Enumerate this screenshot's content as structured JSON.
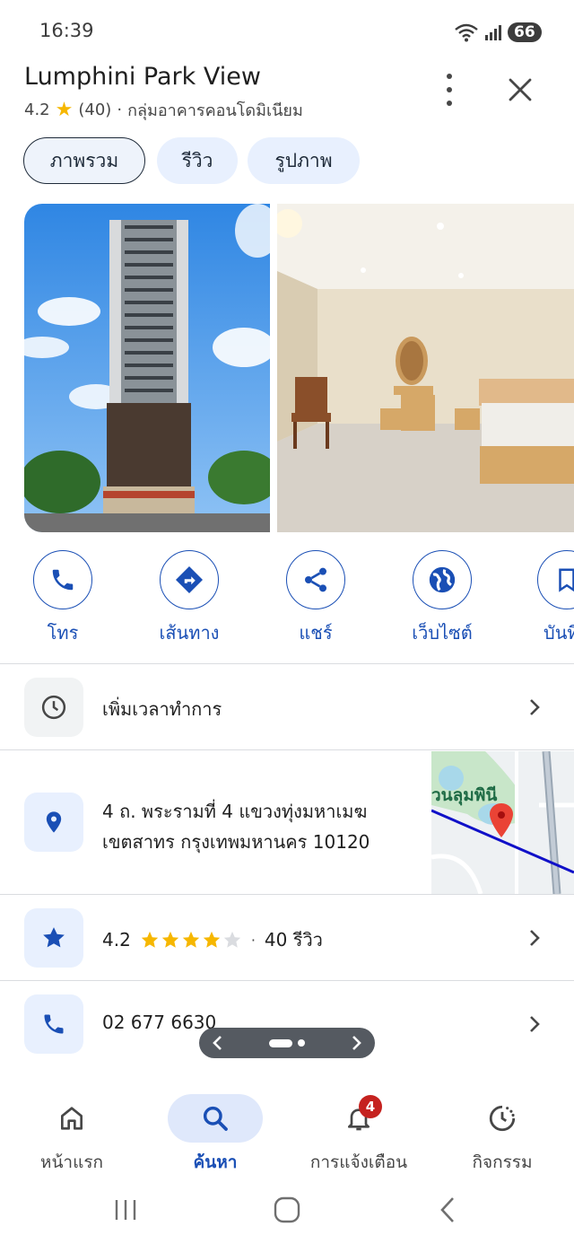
{
  "status_bar": {
    "time": "16:39",
    "battery": "66"
  },
  "place": {
    "name": "Lumphini Park View",
    "rating": "4.2",
    "review_count": "(40)",
    "separator": "·",
    "category": "กลุ่มอาคารคอนโดมิเนียม"
  },
  "tabs": [
    {
      "label": "ภาพรวม",
      "selected": true
    },
    {
      "label": "รีวิว",
      "selected": false
    },
    {
      "label": "รูปภาพ",
      "selected": false
    }
  ],
  "actions": [
    {
      "label": "โทร",
      "icon": "phone-icon"
    },
    {
      "label": "เส้นทาง",
      "icon": "directions-icon"
    },
    {
      "label": "แชร์",
      "icon": "share-icon"
    },
    {
      "label": "เว็บไซต์",
      "icon": "globe-icon"
    },
    {
      "label": "บันทึ",
      "icon": "bookmark-icon"
    }
  ],
  "info_rows": {
    "hours": "เพิ่มเวลาทำการ",
    "address_line1": "4 ถ. พระรามที่ 4 แขวงทุ่งมหาเมฆ",
    "address_line2": "เขตสาทร กรุงเทพมหานคร 10120",
    "rating_value": "4.2",
    "rating_stars": 4,
    "rating_separator": "·",
    "reviews_text": "40 รีวิว",
    "phone": "02 677 6630"
  },
  "map": {
    "label": "วนลุมพินี"
  },
  "bottom_nav": [
    {
      "label": "หน้าแรก",
      "icon": "home-icon",
      "active": false
    },
    {
      "label": "ค้นหา",
      "icon": "search-icon",
      "active": true
    },
    {
      "label": "การแจ้งเตือน",
      "icon": "bell-icon",
      "active": false,
      "badge": "4"
    },
    {
      "label": "กิจกรรม",
      "icon": "activity-icon",
      "active": false
    }
  ],
  "colors": {
    "accent": "#1a4fb5",
    "star": "#f6b700",
    "badge": "#c5221f",
    "pin": "#ea4335"
  }
}
